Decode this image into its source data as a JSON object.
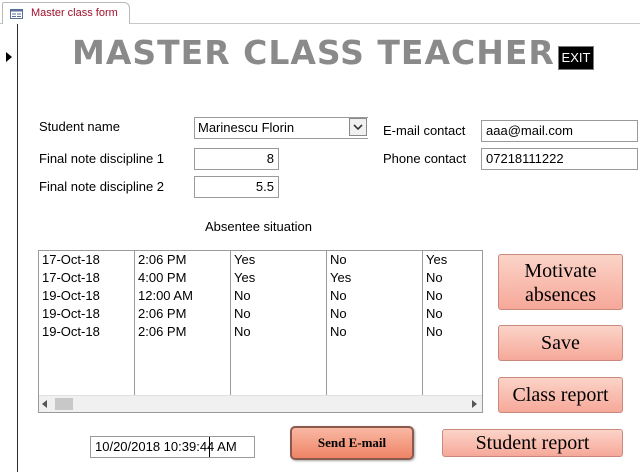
{
  "tab": {
    "title": "Master class form",
    "icon": "form-icon"
  },
  "header": {
    "title": "MASTER CLASS TEACHER",
    "exit_label": "EXIT"
  },
  "fields": {
    "student_name": {
      "label": "Student name",
      "value": "Marinescu Florin"
    },
    "final_note_1": {
      "label": "Final note discipline 1",
      "value": "8"
    },
    "final_note_2": {
      "label": "Final note discipline 2",
      "value": "5.5"
    },
    "email": {
      "label": "E-mail contact",
      "value": "aaa@mail.com"
    },
    "phone": {
      "label": "Phone contact",
      "value": "07218111222"
    }
  },
  "absentee": {
    "label": "Absentee situation",
    "rows": [
      [
        "17-Oct-18",
        "2:06 PM",
        "Yes",
        "No",
        "Yes"
      ],
      [
        "17-Oct-18",
        "4:00 PM",
        "Yes",
        "Yes",
        "No"
      ],
      [
        "19-Oct-18",
        "12:00 AM",
        "No",
        "No",
        "No"
      ],
      [
        "19-Oct-18",
        "2:06 PM",
        "No",
        "No",
        "No"
      ],
      [
        "19-Oct-18",
        "2:06 PM",
        "No",
        "No",
        "No"
      ]
    ]
  },
  "buttons": {
    "motivate_line1": "Motivate",
    "motivate_line2": "absences",
    "save": "Save",
    "class_report": "Class report",
    "student_report": "Student report",
    "send_email": "Send E-mail"
  },
  "footer": {
    "datetime": "10/20/2018 10:39:44 AM"
  }
}
